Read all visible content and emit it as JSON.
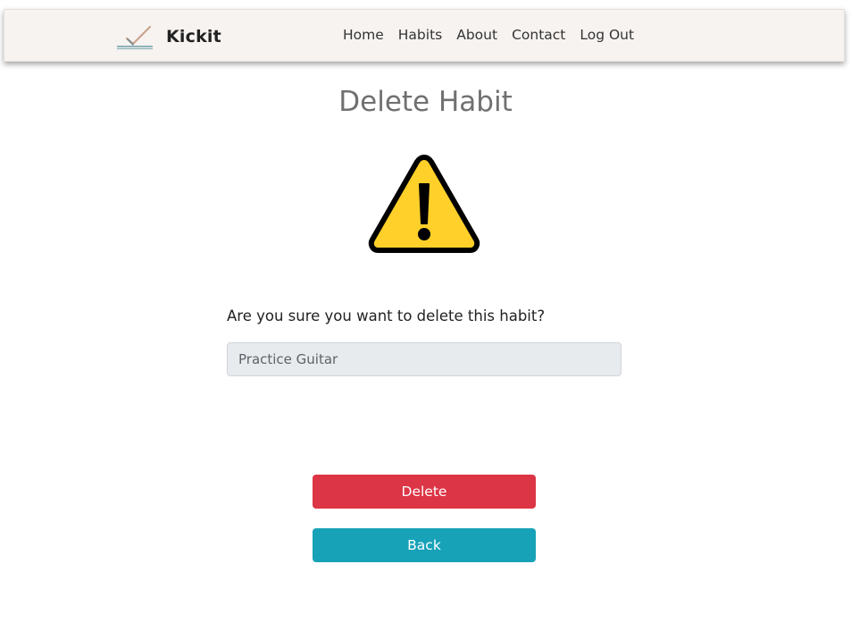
{
  "brand": {
    "name": "Kickit",
    "logo_icon": "checkmark-logo-icon"
  },
  "nav": {
    "items": [
      {
        "label": "Home"
      },
      {
        "label": "Habits"
      },
      {
        "label": "About"
      },
      {
        "label": "Contact"
      },
      {
        "label": "Log Out"
      }
    ]
  },
  "main": {
    "title": "Delete Habit",
    "warning_icon": "warning-triangle-icon",
    "question": "Are you sure you want to delete this habit?",
    "habit_name": "Practice Guitar",
    "delete_label": "Delete",
    "back_label": "Back"
  },
  "colors": {
    "navbar_bg": "#f7f3f1",
    "delete_button": "#dc3545",
    "back_button": "#17a2b8",
    "warning_fill": "#ffd02a"
  }
}
